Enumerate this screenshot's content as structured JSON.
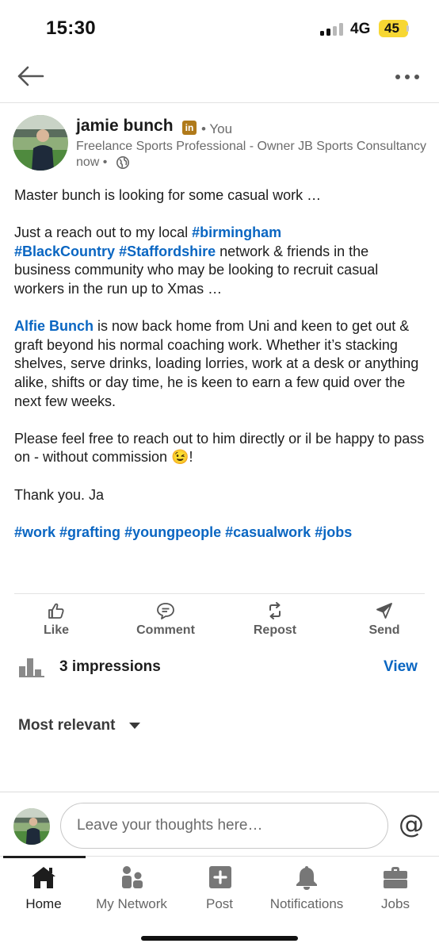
{
  "status_bar": {
    "time": "15:30",
    "network": "4G",
    "battery": "45",
    "battery_color": "#f7d733"
  },
  "top_nav": {
    "back_icon": "arrow-left-icon",
    "more_icon": "more-horizontal-icon"
  },
  "author": {
    "name": "jamie bunch",
    "badge": "in",
    "relation": "• You",
    "headline": "Freelance Sports Professional - Owner JB Sports Consultancy",
    "time": "now •",
    "visibility_icon": "globe-icon"
  },
  "post": {
    "p1": "Master bunch is looking for some casual work …",
    "p2_intro": "Just a reach out to my local ",
    "p2_tag1": "#birmingham",
    "p2_tag2": "#BlackCountry",
    "p2_tag3": "#Staffordshire",
    "p2_rest": " network & friends in the business community who may be looking to recruit casual workers in the run up to Xmas …",
    "p3_mention": "Alfie Bunch",
    "p3_rest": " is now back home from Uni and keen to get out & graft beyond his normal coaching work. Whether it’s stacking shelves, serve drinks, loading lorries, work at a desk or anything alike, shifts or day time, he is keen to earn a few quid over the next few weeks.",
    "p4": "Please feel free to reach out to him directly or il be happy to pass on - without commission 😉!",
    "p5": "Thank you. Ja",
    "hashtags": [
      "#work",
      "#grafting",
      "#youngpeople",
      "#casualwork",
      "#jobs"
    ]
  },
  "actions": {
    "like": "Like",
    "comment": "Comment",
    "repost": "Repost",
    "send": "Send"
  },
  "impressions": {
    "text": "3 impressions",
    "view": "View"
  },
  "sort": {
    "label": "Most relevant"
  },
  "comment_bar": {
    "placeholder": "Leave your thoughts here…",
    "mention": "@"
  },
  "bottom_nav": {
    "home": "Home",
    "network": "My Network",
    "post": "Post",
    "notifications": "Notifications",
    "jobs": "Jobs"
  },
  "colors": {
    "link_blue": "#0a66c2",
    "linkedin_badge": "#b07a1a",
    "muted_text": "#6b6b6b"
  }
}
